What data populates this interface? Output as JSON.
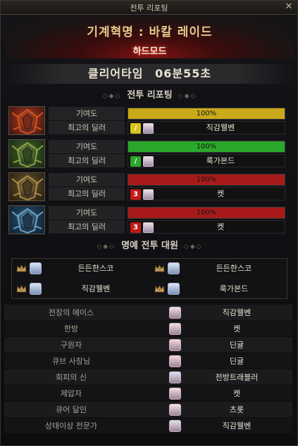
{
  "window": {
    "title": "전투 리포팅",
    "close_glyph": "✕"
  },
  "banner": {
    "boss": "기계혁명 : 바칼 레이드",
    "mode": "하드모드"
  },
  "clear": {
    "label": "클리어타임",
    "time": "06분55초"
  },
  "report": {
    "header": "전투 리포팅",
    "contrib_label": "기여도",
    "dealer_label": "최고의 딜러",
    "parties": [
      {
        "contrib_pct": "100%",
        "contrib_value": 1.0,
        "bar_color": "#c9a91a",
        "job_glyph": "/",
        "job_color": "#d8c21a",
        "dealer": "직감웰벤",
        "crest": "red"
      },
      {
        "contrib_pct": "100%",
        "contrib_value": 1.0,
        "bar_color": "#2aa82a",
        "job_glyph": "/",
        "job_color": "#2aa82a",
        "dealer": "룩가본드",
        "crest": "green"
      },
      {
        "contrib_pct": "100%",
        "contrib_value": 1.0,
        "bar_color": "#a81a1a",
        "job_glyph": "3",
        "job_color": "#c31818",
        "dealer": "켓",
        "crest": "gold"
      },
      {
        "contrib_pct": "100%",
        "contrib_value": 1.0,
        "bar_color": "#a81a1a",
        "job_glyph": "3",
        "job_color": "#c31818",
        "dealer": "켓",
        "crest": "blue"
      }
    ]
  },
  "honor": {
    "header": "명예 전투 대원",
    "members": [
      "든든한스코",
      "든든한스코",
      "직감웰벤",
      "룩가본드"
    ]
  },
  "awards": [
    {
      "title": "전장의 에이스",
      "name": "직감웰벤"
    },
    {
      "title": "한방",
      "name": "켓"
    },
    {
      "title": "구원자",
      "name": "딘귤"
    },
    {
      "title": "큐브 사장님",
      "name": "딘귤"
    },
    {
      "title": "회피의 신",
      "name": "전방트래블러"
    },
    {
      "title": "제압자",
      "name": "켓"
    },
    {
      "title": "큐어 달인",
      "name": "츠롯"
    },
    {
      "title": "상태이상 전문가",
      "name": "직감웰벤"
    }
  ]
}
